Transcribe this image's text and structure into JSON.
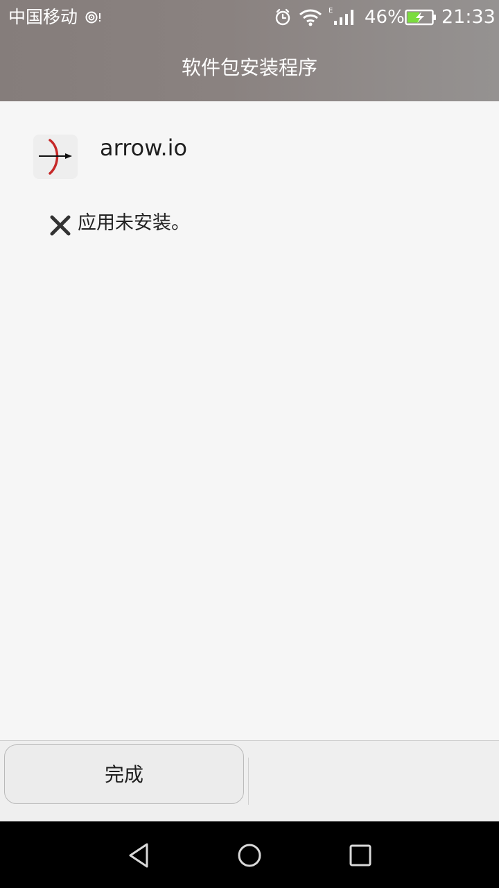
{
  "status_bar": {
    "carrier": "中国移动",
    "battery_percent": "46%",
    "time": "21:33",
    "network_type": "E",
    "icons": [
      "hotspot-icon",
      "alarm-icon",
      "wifi-icon",
      "cellular-signal-icon",
      "battery-charging-icon"
    ]
  },
  "header": {
    "title": "软件包安装程序"
  },
  "app": {
    "name": "arrow.io",
    "icon": "arrow-io-app-icon"
  },
  "install_status": {
    "icon": "close-icon",
    "message": "应用未安装。"
  },
  "actions": {
    "done_label": "完成"
  },
  "navigation": {
    "icons": [
      "back-icon",
      "home-icon",
      "recent-apps-icon"
    ]
  },
  "colors": {
    "header_background": "#8a8280",
    "content_background": "#f6f6f6",
    "button_background": "#ececec",
    "nav_background": "#000000",
    "app_arrow_red": "#c62828"
  }
}
